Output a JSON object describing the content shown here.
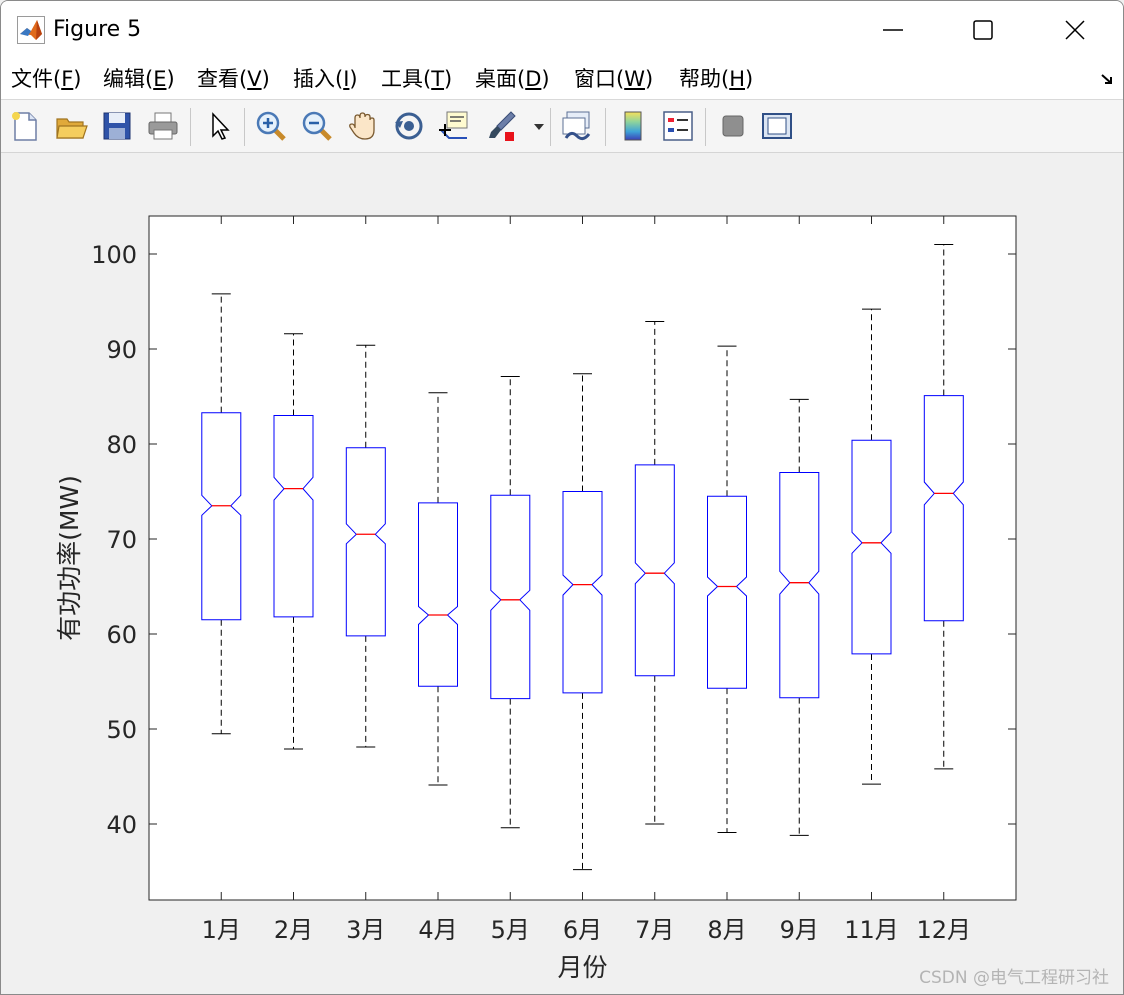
{
  "window": {
    "title": "Figure 5"
  },
  "menu": [
    {
      "name": "menu-file",
      "pre": "文件(",
      "acc": "F",
      "post": ")"
    },
    {
      "name": "menu-edit",
      "pre": "编辑(",
      "acc": "E",
      "post": ")"
    },
    {
      "name": "menu-view",
      "pre": "查看(",
      "acc": "V",
      "post": ")"
    },
    {
      "name": "menu-insert",
      "pre": "插入(",
      "acc": "I",
      "post": ")"
    },
    {
      "name": "menu-tools",
      "pre": "工具(",
      "acc": "T",
      "post": ")"
    },
    {
      "name": "menu-desktop",
      "pre": "桌面(",
      "acc": "D",
      "post": ")"
    },
    {
      "name": "menu-window",
      "pre": "窗口(",
      "acc": "W",
      "post": ")"
    },
    {
      "name": "menu-help",
      "pre": "帮助(",
      "acc": "H",
      "post": ")"
    }
  ],
  "toolbar": [
    "new-figure-icon",
    "open-file-icon",
    "save-icon",
    "print-icon",
    "edit-plot-arrow-icon",
    "zoom-in-icon",
    "zoom-out-icon",
    "pan-hand-icon",
    "rotate-3d-icon",
    "data-cursor-icon",
    "brush-icon",
    "link-plot-icon",
    "colorbar-icon",
    "legend-icon",
    "hide-plot-tools-icon",
    "show-plot-tools-icon"
  ],
  "watermark": "CSDN @电气工程研习社",
  "colors": {
    "box": "#0000ff",
    "median": "#ff0000",
    "whisker": "#000000",
    "axes_background": "#ffffff",
    "figure_background": "#f0f0f0"
  },
  "chart_data": {
    "type": "boxplot",
    "notched": true,
    "title": "",
    "xlabel": "月份",
    "ylabel": "有功功率(MW)",
    "ylim": [
      32,
      104
    ],
    "yticks": [
      40,
      50,
      60,
      70,
      80,
      90,
      100
    ],
    "grid": false,
    "categories": [
      "1月",
      "2月",
      "3月",
      "4月",
      "5月",
      "6月",
      "7月",
      "8月",
      "9月",
      "11月",
      "12月"
    ],
    "boxes": [
      {
        "whisker_low": 49.5,
        "q1": 61.5,
        "median": 73.5,
        "q3": 83.3,
        "whisker_high": 95.8,
        "notch_low": 72.5,
        "notch_high": 74.6
      },
      {
        "whisker_low": 47.9,
        "q1": 61.8,
        "median": 75.3,
        "q3": 83.0,
        "whisker_high": 91.6,
        "notch_low": 74.1,
        "notch_high": 76.5
      },
      {
        "whisker_low": 48.1,
        "q1": 59.8,
        "median": 70.5,
        "q3": 79.6,
        "whisker_high": 90.4,
        "notch_low": 69.5,
        "notch_high": 71.6
      },
      {
        "whisker_low": 44.1,
        "q1": 54.5,
        "median": 62.0,
        "q3": 73.8,
        "whisker_high": 85.4,
        "notch_low": 61.0,
        "notch_high": 62.9
      },
      {
        "whisker_low": 39.6,
        "q1": 53.2,
        "median": 63.6,
        "q3": 74.6,
        "whisker_high": 87.1,
        "notch_low": 62.5,
        "notch_high": 64.6
      },
      {
        "whisker_low": 35.2,
        "q1": 53.8,
        "median": 65.2,
        "q3": 75.0,
        "whisker_high": 87.4,
        "notch_low": 64.1,
        "notch_high": 66.2
      },
      {
        "whisker_low": 40.0,
        "q1": 55.6,
        "median": 66.4,
        "q3": 77.8,
        "whisker_high": 92.9,
        "notch_low": 65.3,
        "notch_high": 67.5
      },
      {
        "whisker_low": 39.1,
        "q1": 54.3,
        "median": 65.0,
        "q3": 74.5,
        "whisker_high": 90.3,
        "notch_low": 64.0,
        "notch_high": 66.0
      },
      {
        "whisker_low": 38.8,
        "q1": 53.3,
        "median": 65.4,
        "q3": 77.0,
        "whisker_high": 84.7,
        "notch_low": 64.2,
        "notch_high": 66.6
      },
      {
        "whisker_low": 44.2,
        "q1": 57.9,
        "median": 69.6,
        "q3": 80.4,
        "whisker_high": 94.2,
        "notch_low": 68.5,
        "notch_high": 70.7
      },
      {
        "whisker_low": 45.8,
        "q1": 61.4,
        "median": 74.8,
        "q3": 85.1,
        "whisker_high": 101.0,
        "notch_low": 73.6,
        "notch_high": 76.0
      }
    ]
  }
}
